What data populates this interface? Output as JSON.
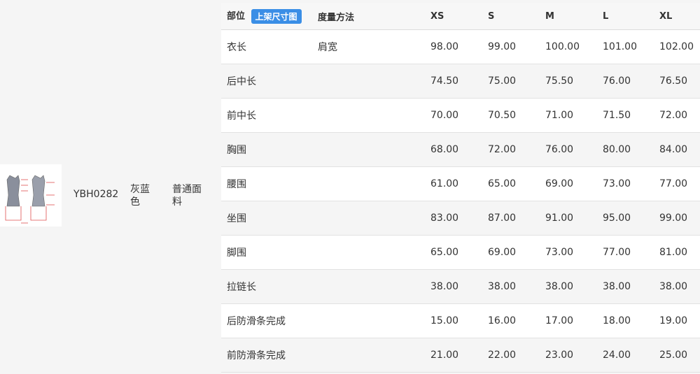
{
  "product": {
    "code": "YBH0282",
    "color": "灰蓝色",
    "fabric": "普通面料",
    "image_name": "dress-size-diagram"
  },
  "table": {
    "header": {
      "part": "部位",
      "upload_button": "上架尺寸图",
      "method": "度量方法",
      "sizes": [
        "XS",
        "S",
        "M",
        "L",
        "XL"
      ]
    },
    "rows": [
      {
        "part": "衣长",
        "method": "肩宽",
        "values": [
          "98.00",
          "99.00",
          "100.00",
          "101.00",
          "102.00"
        ]
      },
      {
        "part": "后中长",
        "method": "",
        "values": [
          "74.50",
          "75.00",
          "75.50",
          "76.00",
          "76.50"
        ]
      },
      {
        "part": "前中长",
        "method": "",
        "values": [
          "70.00",
          "70.50",
          "71.00",
          "71.50",
          "72.00"
        ]
      },
      {
        "part": "胸围",
        "method": "",
        "values": [
          "68.00",
          "72.00",
          "76.00",
          "80.00",
          "84.00"
        ]
      },
      {
        "part": "腰围",
        "method": "",
        "values": [
          "61.00",
          "65.00",
          "69.00",
          "73.00",
          "77.00"
        ]
      },
      {
        "part": "坐围",
        "method": "",
        "values": [
          "83.00",
          "87.00",
          "91.00",
          "95.00",
          "99.00"
        ]
      },
      {
        "part": "脚围",
        "method": "",
        "values": [
          "65.00",
          "69.00",
          "73.00",
          "77.00",
          "81.00"
        ]
      },
      {
        "part": "拉链长",
        "method": "",
        "values": [
          "38.00",
          "38.00",
          "38.00",
          "38.00",
          "38.00"
        ]
      },
      {
        "part": "后防滑条完成",
        "method": "",
        "values": [
          "15.00",
          "16.00",
          "17.00",
          "18.00",
          "19.00"
        ]
      },
      {
        "part": "前防滑条完成",
        "method": "",
        "values": [
          "21.00",
          "22.00",
          "23.00",
          "24.00",
          "25.00"
        ]
      }
    ]
  },
  "colors": {
    "badge": "#3a8ee6",
    "row_odd": "#ffffff",
    "row_even": "#f5f5f5"
  }
}
